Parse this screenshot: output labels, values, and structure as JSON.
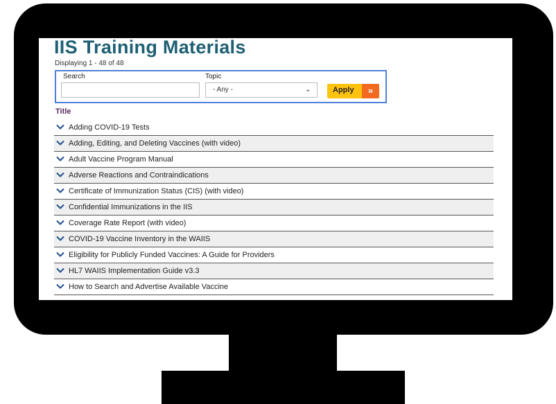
{
  "page": {
    "title": "IIS Training Materials",
    "count_text": "Displaying 1 - 48 of 48"
  },
  "filters": {
    "search_label": "Search",
    "search_value": "",
    "topic_label": "Topic",
    "topic_value": "- Any -",
    "apply_label": "Apply",
    "apply_icon": "»"
  },
  "table": {
    "header": "Title",
    "rows": [
      "Adding COVID-19 Tests",
      "Adding, Editing, and Deleting Vaccines (with video)",
      "Adult Vaccine Program Manual",
      "Adverse Reactions and Contraindications",
      "Certificate of Immunization Status (CIS) (with video)",
      "Confidential Immunizations in the IIS",
      "Coverage Rate Report (with video)",
      "COVID-19 Vaccine Inventory in the WAIIS",
      "Eligibility for Publicly Funded Vaccines: A Guide for Providers",
      "HL7 WAIIS Implementation Guide v3.3",
      "How to Search and Advertise Available Vaccine"
    ]
  },
  "colors": {
    "title": "#1e5f74",
    "header": "#5a2a5e",
    "apply_bg": "#ffc20e",
    "apply_arrow_bg": "#f26b21",
    "filter_border": "#4d7fd9",
    "chevron": "#1e4f8a"
  }
}
